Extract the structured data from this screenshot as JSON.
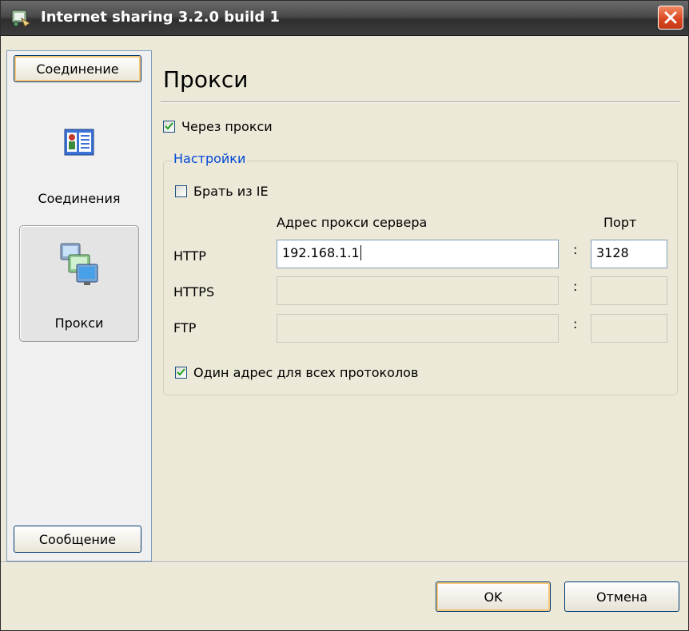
{
  "window": {
    "title": "Internet sharing 3.2.0 build 1"
  },
  "sidebar": {
    "header_label": "Соединение",
    "footer_label": "Сообщение",
    "items": [
      {
        "label": "Соединения",
        "icon": "contacts-card-icon",
        "selected": false
      },
      {
        "label": "Прокси",
        "icon": "network-computers-icon",
        "selected": true
      }
    ]
  },
  "main": {
    "title": "Прокси",
    "use_proxy": {
      "label": "Через прокси",
      "checked": true
    },
    "settings": {
      "title": "Настройки",
      "from_ie": {
        "label": "Брать из IE",
        "checked": false
      },
      "address_header": "Адрес прокси сервера",
      "port_header": "Порт",
      "rows": [
        {
          "protocol": "HTTP",
          "address": "192.168.1.1",
          "port": "3128",
          "enabled": true
        },
        {
          "protocol": "HTTPS",
          "address": "",
          "port": "",
          "enabled": false
        },
        {
          "protocol": "FTP",
          "address": "",
          "port": "",
          "enabled": false
        }
      ],
      "colon": ":",
      "same_for_all": {
        "label": "Один адрес для всех протоколов",
        "checked": true
      }
    }
  },
  "buttons": {
    "ok": "OK",
    "cancel": "Отмена"
  }
}
